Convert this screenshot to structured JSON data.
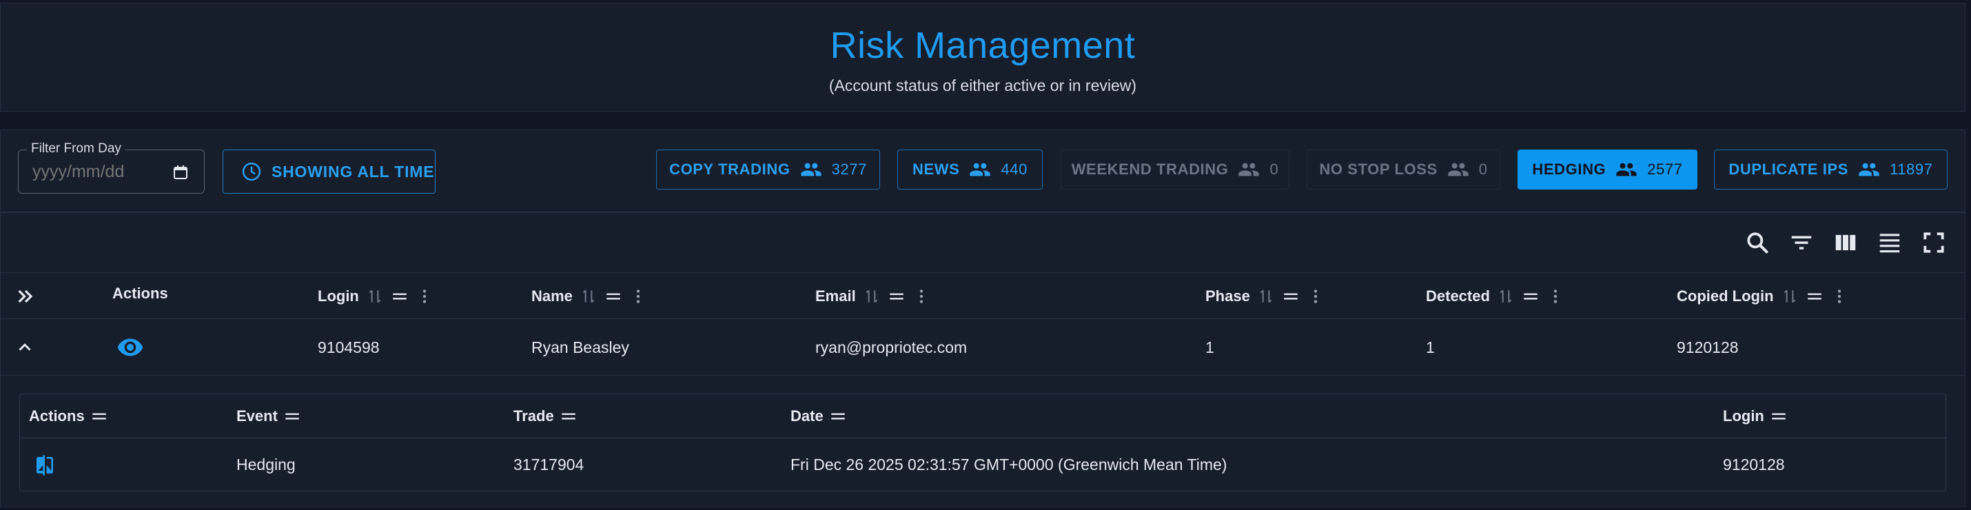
{
  "header": {
    "title": "Risk Management",
    "subtitle": "(Account status of either active or in review)"
  },
  "filters": {
    "date_label": "Filter From Day",
    "date_placeholder": "yyyy/mm/dd",
    "time_button": "SHOWING ALL TIME",
    "chips": [
      {
        "label": "COPY TRADING",
        "count": "3277",
        "state": "outlined"
      },
      {
        "label": "NEWS",
        "count": "440",
        "state": "outlined"
      },
      {
        "label": "WEEKEND TRADING",
        "count": "0",
        "state": "disabled"
      },
      {
        "label": "NO STOP LOSS",
        "count": "0",
        "state": "disabled"
      },
      {
        "label": "HEDGING",
        "count": "2577",
        "state": "active"
      },
      {
        "label": "DUPLICATE IPS",
        "count": "11897",
        "state": "outlined"
      }
    ]
  },
  "toolbar": [
    "search-icon",
    "filter-icon",
    "columns-icon",
    "density-icon",
    "fullscreen-icon"
  ],
  "table": {
    "columns": {
      "actions": "Actions",
      "login": "Login",
      "name": "Name",
      "email": "Email",
      "phase": "Phase",
      "detected": "Detected",
      "copied_login": "Copied Login"
    },
    "row": {
      "login": "9104598",
      "name": "Ryan Beasley",
      "email": "ryan@propriotec.com",
      "phase": "1",
      "detected": "1",
      "copied_login": "9120128"
    }
  },
  "subtable": {
    "columns": {
      "actions": "Actions",
      "event": "Event",
      "trade": "Trade",
      "date": "Date",
      "login": "Login"
    },
    "row": {
      "event": "Hedging",
      "trade": "31717904",
      "date": "Fri Dec 26 2025 02:31:57 GMT+0000 (Greenwich Mean Time)",
      "login": "9120128"
    }
  },
  "colors": {
    "accent": "#1f9bf0",
    "active_chip": "#0d96f0",
    "background": "#101624",
    "panel": "#161d2b"
  }
}
